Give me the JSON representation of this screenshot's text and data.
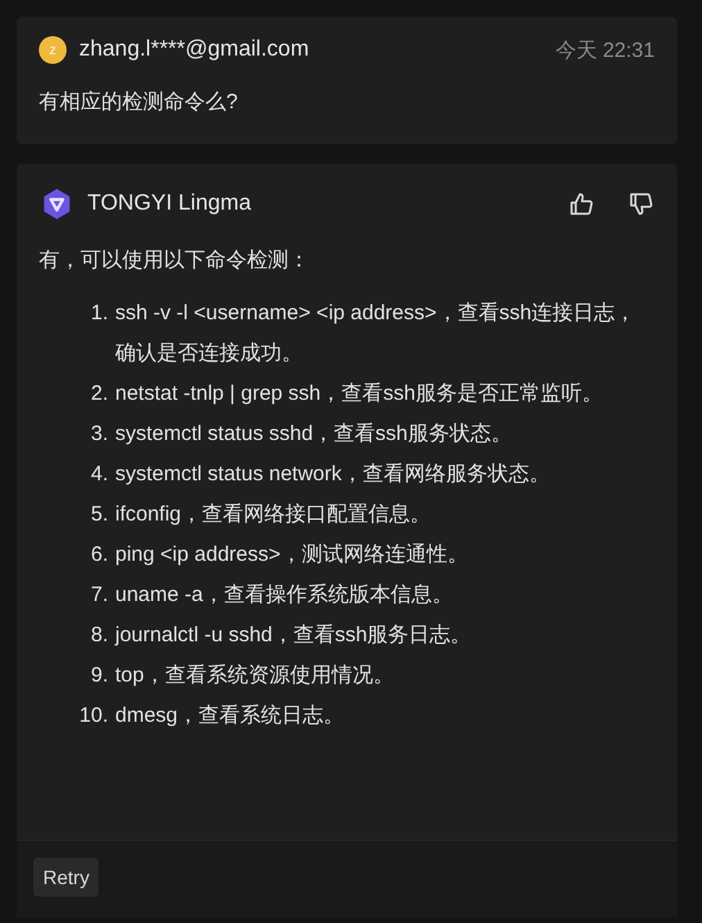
{
  "user_message": {
    "avatar": "z",
    "author": "zhang.l****@gmail.com",
    "time": "今天 22:31",
    "text": "有相应的检测命令么?"
  },
  "assistant_message": {
    "author": "TONGYI Lingma",
    "intro": "有，可以使用以下命令检测：",
    "items": [
      {
        "number": "1.",
        "text": "ssh -v -l <username> <ip address>，查看ssh连接日志，确认是否连接成功。"
      },
      {
        "number": "2.",
        "text": "netstat -tnlp | grep ssh，查看ssh服务是否正常监听。"
      },
      {
        "number": "3.",
        "text": "systemctl status sshd，查看ssh服务状态。"
      },
      {
        "number": "4.",
        "text": "systemctl status network，查看网络服务状态。"
      },
      {
        "number": "5.",
        "text": "ifconfig，查看网络接口配置信息。"
      },
      {
        "number": "6.",
        "text": "ping <ip address>，测试网络连通性。"
      },
      {
        "number": "7.",
        "text": "uname -a，查看操作系统版本信息。"
      },
      {
        "number": "8.",
        "text": "journalctl -u sshd，查看ssh服务日志。"
      },
      {
        "number": "9.",
        "text": "top，查看系统资源使用情况。"
      },
      {
        "number": "10.",
        "text": "dmesg，查看系统日志。"
      }
    ]
  },
  "footer": {
    "retry_button": "Retry"
  }
}
